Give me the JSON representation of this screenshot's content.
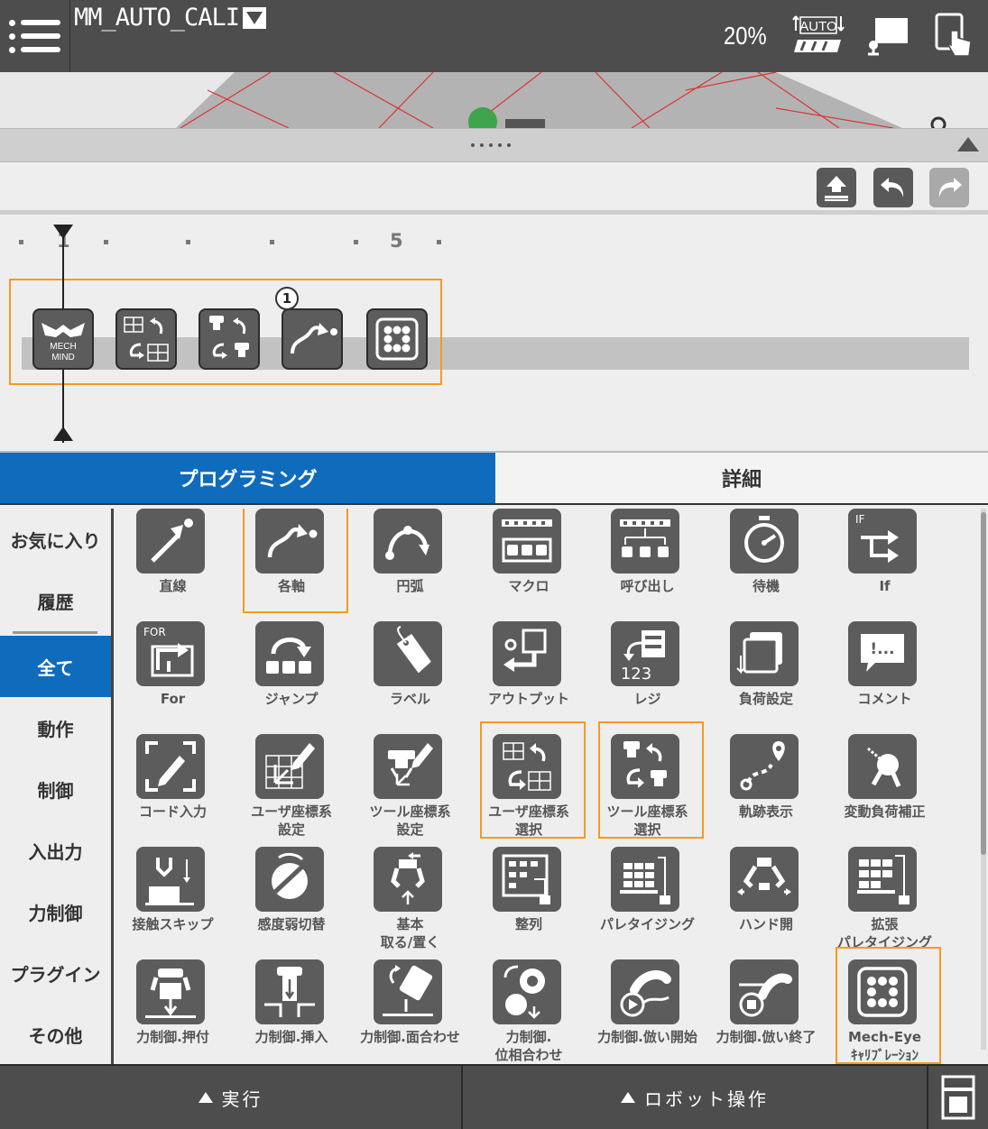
{
  "header": {
    "program_name": "MM_AUTO_CALI",
    "speed": "20%",
    "mode_icon_text": "AUTO"
  },
  "timeline": {
    "ruler_labels": [
      "1",
      "5"
    ],
    "step_badge": "1",
    "commands": [
      {
        "name": "mech-mind-icon",
        "text_line1": "MECH",
        "text_line2": "MIND"
      },
      {
        "name": "user-frame-select-icon"
      },
      {
        "name": "tool-frame-select-icon"
      },
      {
        "name": "joint-move-icon"
      },
      {
        "name": "mech-eye-calibration-icon"
      }
    ]
  },
  "tabs": {
    "programming": "プログラミング",
    "details": "詳細"
  },
  "categories": [
    "お気に入り",
    "履歴",
    "全て",
    "動作",
    "制御",
    "入出力",
    "力制御",
    "プラグイン",
    "その他"
  ],
  "palette": {
    "items": [
      {
        "label": "直線",
        "icon": "linear-move-icon",
        "tag": ""
      },
      {
        "label": "各軸",
        "icon": "joint-move-icon",
        "tag": ""
      },
      {
        "label": "円弧",
        "icon": "arc-move-icon",
        "tag": ""
      },
      {
        "label": "マクロ",
        "icon": "macro-icon",
        "tag": ""
      },
      {
        "label": "呼び出し",
        "icon": "call-icon",
        "tag": ""
      },
      {
        "label": "待機",
        "icon": "wait-icon",
        "tag": ""
      },
      {
        "label": "If",
        "icon": "if-icon",
        "tag": "IF"
      },
      {
        "label": "For",
        "icon": "for-icon",
        "tag": "FOR"
      },
      {
        "label": "ジャンプ",
        "icon": "jump-icon",
        "tag": ""
      },
      {
        "label": "ラベル",
        "icon": "label-icon",
        "tag": ""
      },
      {
        "label": "アウトプット",
        "icon": "output-icon",
        "tag": ""
      },
      {
        "label": "レジ",
        "icon": "register-icon",
        "tag": "123"
      },
      {
        "label": "負荷設定",
        "icon": "payload-setting-icon",
        "tag": ""
      },
      {
        "label": "コメント",
        "icon": "comment-icon",
        "tag": "!..."
      },
      {
        "label": "コード入力",
        "icon": "code-input-icon",
        "tag": ""
      },
      {
        "label": "ユーザ座標系\n設定",
        "icon": "user-frame-setting-icon",
        "tag": ""
      },
      {
        "label": "ツール座標系\n設定",
        "icon": "tool-frame-setting-icon",
        "tag": ""
      },
      {
        "label": "ユーザ座標系\n選択",
        "icon": "user-frame-select-icon",
        "tag": ""
      },
      {
        "label": "ツール座標系\n選択",
        "icon": "tool-frame-select-icon",
        "tag": ""
      },
      {
        "label": "軌跡表示",
        "icon": "trajectory-display-icon",
        "tag": ""
      },
      {
        "label": "変動負荷補正",
        "icon": "variable-payload-icon",
        "tag": ""
      },
      {
        "label": "接触スキップ",
        "icon": "touch-skip-icon",
        "tag": ""
      },
      {
        "label": "感度弱切替",
        "icon": "sensitivity-icon",
        "tag": ""
      },
      {
        "label": "基本\n取る/置く",
        "icon": "pick-place-icon",
        "tag": ""
      },
      {
        "label": "整列",
        "icon": "align-icon",
        "tag": ""
      },
      {
        "label": "パレタイジング",
        "icon": "palletizing-icon",
        "tag": ""
      },
      {
        "label": "ハンド開",
        "icon": "hand-open-icon",
        "tag": ""
      },
      {
        "label": "拡張\nパレタイジング",
        "icon": "ext-palletizing-icon",
        "tag": ""
      },
      {
        "label": "力制御.押付",
        "icon": "force-press-icon",
        "tag": ""
      },
      {
        "label": "力制御.挿入",
        "icon": "force-insert-icon",
        "tag": ""
      },
      {
        "label": "力制御.面合わせ",
        "icon": "force-surface-icon",
        "tag": ""
      },
      {
        "label": "力制御.\n位相合わせ",
        "icon": "force-phase-icon",
        "tag": ""
      },
      {
        "label": "力制御.倣い開始",
        "icon": "force-follow-start-icon",
        "tag": ""
      },
      {
        "label": "力制御.倣い終了",
        "icon": "force-follow-end-icon",
        "tag": ""
      },
      {
        "label": "Mech-Eye\nｷｬﾘﾌﾞﾚｰｼｮﾝ",
        "icon": "mech-eye-calibration-icon",
        "tag": ""
      }
    ]
  },
  "bottombar": {
    "run": "実行",
    "robot_operation": "ロボット操作"
  },
  "colors": {
    "accent": "#0f6cbd",
    "highlight": "#f59a23",
    "tile": "#5c5c5c",
    "bar": "#4d4d4d"
  }
}
